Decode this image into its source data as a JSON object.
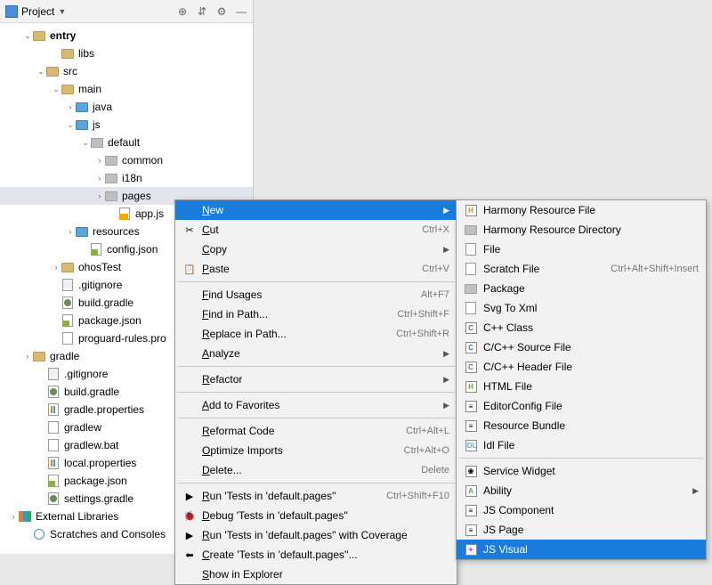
{
  "panel": {
    "title": "Project"
  },
  "tree": [
    {
      "indent": 26,
      "arrow": "v",
      "icon": "folder",
      "label": "entry",
      "bold": true
    },
    {
      "indent": 58,
      "arrow": "",
      "icon": "folder",
      "label": "libs"
    },
    {
      "indent": 41,
      "arrow": "v",
      "icon": "folder",
      "label": "src"
    },
    {
      "indent": 58,
      "arrow": "v",
      "icon": "folder",
      "label": "main"
    },
    {
      "indent": 74,
      "arrow": ">",
      "icon": "folder-blue",
      "label": "java"
    },
    {
      "indent": 74,
      "arrow": "v",
      "icon": "folder-blue",
      "label": "js"
    },
    {
      "indent": 91,
      "arrow": "v",
      "icon": "folder-gray",
      "label": "default"
    },
    {
      "indent": 107,
      "arrow": ">",
      "icon": "folder-gray",
      "label": "common"
    },
    {
      "indent": 107,
      "arrow": ">",
      "icon": "folder-gray",
      "label": "i18n"
    },
    {
      "indent": 107,
      "arrow": ">",
      "icon": "folder-gray",
      "label": "pages",
      "highlighted": true
    },
    {
      "indent": 122,
      "arrow": "",
      "icon": "file-js",
      "label": "app.js"
    },
    {
      "indent": 74,
      "arrow": ">",
      "icon": "folder-blue",
      "label": "resources"
    },
    {
      "indent": 90,
      "arrow": "",
      "icon": "file-json",
      "label": "config.json"
    },
    {
      "indent": 58,
      "arrow": ">",
      "icon": "folder",
      "label": "ohosTest"
    },
    {
      "indent": 58,
      "arrow": "",
      "icon": "file-git",
      "label": ".gitignore"
    },
    {
      "indent": 58,
      "arrow": "",
      "icon": "file-gradle",
      "label": "build.gradle"
    },
    {
      "indent": 58,
      "arrow": "",
      "icon": "file-json",
      "label": "package.json"
    },
    {
      "indent": 58,
      "arrow": "",
      "icon": "file",
      "label": "proguard-rules.pro"
    },
    {
      "indent": 26,
      "arrow": ">",
      "icon": "folder",
      "label": "gradle"
    },
    {
      "indent": 42,
      "arrow": "",
      "icon": "file-git",
      "label": ".gitignore"
    },
    {
      "indent": 42,
      "arrow": "",
      "icon": "file-gradle",
      "label": "build.gradle"
    },
    {
      "indent": 42,
      "arrow": "",
      "icon": "file-props",
      "label": "gradle.properties"
    },
    {
      "indent": 42,
      "arrow": "",
      "icon": "file",
      "label": "gradlew"
    },
    {
      "indent": 42,
      "arrow": "",
      "icon": "file",
      "label": "gradlew.bat"
    },
    {
      "indent": 42,
      "arrow": "",
      "icon": "file-props",
      "label": "local.properties"
    },
    {
      "indent": 42,
      "arrow": "",
      "icon": "file-json",
      "label": "package.json"
    },
    {
      "indent": 42,
      "arrow": "",
      "icon": "file-gradle",
      "label": "settings.gradle"
    },
    {
      "indent": 10,
      "arrow": ">",
      "icon": "lib",
      "label": "External Libraries"
    },
    {
      "indent": 26,
      "arrow": "",
      "icon": "scratch",
      "label": "Scratches and Consoles"
    }
  ],
  "contextMenu": [
    {
      "type": "item",
      "icon": "",
      "label": "New",
      "selected": true,
      "arrow": true
    },
    {
      "type": "item",
      "icon": "✂",
      "label": "Cut",
      "shortcut": "Ctrl+X"
    },
    {
      "type": "item",
      "icon": "",
      "label": "Copy",
      "arrow": true
    },
    {
      "type": "item",
      "icon": "📋",
      "label": "Paste",
      "shortcut": "Ctrl+V"
    },
    {
      "type": "sep"
    },
    {
      "type": "item",
      "icon": "",
      "label": "Find Usages",
      "shortcut": "Alt+F7"
    },
    {
      "type": "item",
      "icon": "",
      "label": "Find in Path...",
      "shortcut": "Ctrl+Shift+F"
    },
    {
      "type": "item",
      "icon": "",
      "label": "Replace in Path...",
      "shortcut": "Ctrl+Shift+R"
    },
    {
      "type": "item",
      "icon": "",
      "label": "Analyze",
      "arrow": true
    },
    {
      "type": "sep"
    },
    {
      "type": "item",
      "icon": "",
      "label": "Refactor",
      "arrow": true
    },
    {
      "type": "sep"
    },
    {
      "type": "item",
      "icon": "",
      "label": "Add to Favorites",
      "arrow": true
    },
    {
      "type": "sep"
    },
    {
      "type": "item",
      "icon": "",
      "label": "Reformat Code",
      "shortcut": "Ctrl+Alt+L"
    },
    {
      "type": "item",
      "icon": "",
      "label": "Optimize Imports",
      "shortcut": "Ctrl+Alt+O"
    },
    {
      "type": "item",
      "icon": "",
      "label": "Delete...",
      "shortcut": "Delete"
    },
    {
      "type": "sep"
    },
    {
      "type": "item",
      "icon": "▶",
      "label": "Run 'Tests in 'default.pages''",
      "shortcut": "Ctrl+Shift+F10"
    },
    {
      "type": "item",
      "icon": "🐞",
      "label": "Debug 'Tests in 'default.pages''"
    },
    {
      "type": "item",
      "icon": "▶",
      "label": "Run 'Tests in 'default.pages'' with Coverage"
    },
    {
      "type": "item",
      "icon": "⬅",
      "label": "Create 'Tests in 'default.pages''..."
    },
    {
      "type": "item",
      "icon": "",
      "label": "Show in Explorer"
    }
  ],
  "submenu": [
    {
      "icon": "H",
      "iconColor": "#e67e22",
      "label": "Harmony Resource File"
    },
    {
      "icon": "folder",
      "label": "Harmony Resource Directory"
    },
    {
      "icon": "file",
      "label": "File"
    },
    {
      "icon": "file",
      "label": "Scratch File",
      "shortcut": "Ctrl+Alt+Shift+Insert"
    },
    {
      "icon": "folder",
      "label": "Package"
    },
    {
      "icon": "svg",
      "label": "Svg To Xml"
    },
    {
      "icon": "C",
      "iconColor": "#3a6ea5",
      "label": "C++ Class"
    },
    {
      "icon": "C",
      "iconColor": "#3a6ea5",
      "label": "C/C++ Source File"
    },
    {
      "icon": "C",
      "iconColor": "#805a9c",
      "label": "C/C++ Header File"
    },
    {
      "icon": "H",
      "iconColor": "#5cb033",
      "label": "HTML File"
    },
    {
      "icon": "≡",
      "label": "EditorConfig File"
    },
    {
      "icon": "≡",
      "label": "Resource Bundle"
    },
    {
      "icon": "IDL",
      "iconColor": "#7aa5c4",
      "label": "Idl File"
    },
    {
      "type": "sep"
    },
    {
      "icon": "❀",
      "label": "Service Widget"
    },
    {
      "icon": "A",
      "iconColor": "#5cb033",
      "label": "Ability",
      "arrow": true
    },
    {
      "icon": "≡",
      "label": "JS Component"
    },
    {
      "icon": "≡",
      "label": "JS Page"
    },
    {
      "icon": "✦",
      "iconColor": "#d946ef",
      "label": "JS Visual",
      "selected": true
    }
  ]
}
